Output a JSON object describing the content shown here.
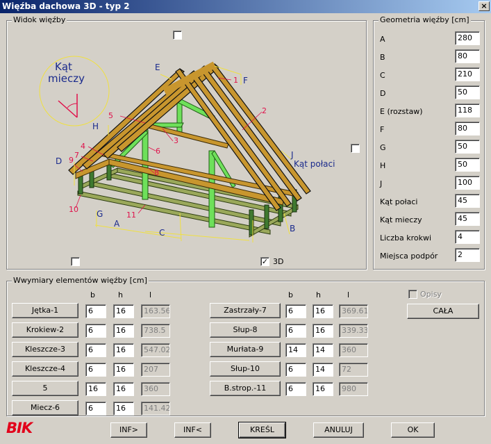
{
  "window": {
    "title": "Więźba dachowa 3D - typ 2",
    "close_glyph": "×"
  },
  "view": {
    "title": "Widok więźby",
    "checkbox_top": false,
    "checkbox_right": false,
    "checkbox_bottom_left": false,
    "checkbox_3d": true,
    "checkbox_3d_label": "3D",
    "check_glyph": "✓",
    "annotations": {
      "kat_mieczy_line1": "Kąt",
      "kat_mieczy_line2": "mieczy",
      "kat_polaci": "Kąt połaci",
      "letters": [
        "A",
        "B",
        "C",
        "D",
        "E",
        "F",
        "G",
        "H",
        "J"
      ],
      "numbers": [
        "1",
        "2",
        "3",
        "4",
        "5",
        "6",
        "7",
        "8",
        "9",
        "10",
        "11"
      ]
    },
    "colors": {
      "timber": "#c8962e",
      "post": "#6ee05a",
      "base": "#9aa85a",
      "dim_line": "#f0e040",
      "dim_text": "#1a2a8c",
      "num_text": "#e0104a"
    }
  },
  "geometry": {
    "title": "Geometria więźby [cm]",
    "rows": [
      {
        "label": "A",
        "value": "280"
      },
      {
        "label": "B",
        "value": "80"
      },
      {
        "label": "C",
        "value": "210"
      },
      {
        "label": "D",
        "value": "50"
      },
      {
        "label": "E (rozstaw)",
        "value": "118"
      },
      {
        "label": "F",
        "value": "80"
      },
      {
        "label": "G",
        "value": "50"
      },
      {
        "label": "H",
        "value": "50"
      },
      {
        "label": "J",
        "value": "100"
      },
      {
        "label": "Kąt połaci",
        "value": "45"
      },
      {
        "label": "Kąt mieczy",
        "value": "45"
      },
      {
        "label": "Liczba krokwi",
        "value": "4"
      },
      {
        "label": "Miejsca podpór",
        "value": "2"
      }
    ]
  },
  "dimensions": {
    "title": "Wwymiary elementów więźby [cm]",
    "col_headers": {
      "b": "b",
      "h": "h",
      "l": "l"
    },
    "left": [
      {
        "name": "Jętka-1",
        "b": "6",
        "h": "16",
        "l": "163.56"
      },
      {
        "name": "Krokiew-2",
        "b": "6",
        "h": "16",
        "l": "738.5"
      },
      {
        "name": "Kleszcze-3",
        "b": "6",
        "h": "16",
        "l": "547.02"
      },
      {
        "name": "Kleszcze-4",
        "b": "6",
        "h": "16",
        "l": "207"
      },
      {
        "name": "5",
        "b": "16",
        "h": "16",
        "l": "360"
      },
      {
        "name": "Miecz-6",
        "b": "6",
        "h": "16",
        "l": "141.42"
      }
    ],
    "right": [
      {
        "name": "Zastrzały-7",
        "b": "6",
        "h": "16",
        "l": "369.61"
      },
      {
        "name": "Słup-8",
        "b": "6",
        "h": "16",
        "l": "339.33"
      },
      {
        "name": "Murłata-9",
        "b": "14",
        "h": "14",
        "l": "360"
      },
      {
        "name": "Słup-10",
        "b": "6",
        "h": "14",
        "l": "72"
      },
      {
        "name": "B.strop.-11",
        "b": "6",
        "h": "16",
        "l": "980"
      }
    ],
    "opisy": {
      "label": "Opisy",
      "checked": false
    },
    "cala_label": "CAŁA"
  },
  "footer": {
    "logo": "BIK",
    "buttons": {
      "inf_next": "INF>",
      "inf_prev": "INF<",
      "kresl": "KREŚL",
      "anuluj": "ANULUJ",
      "ok": "OK"
    }
  }
}
